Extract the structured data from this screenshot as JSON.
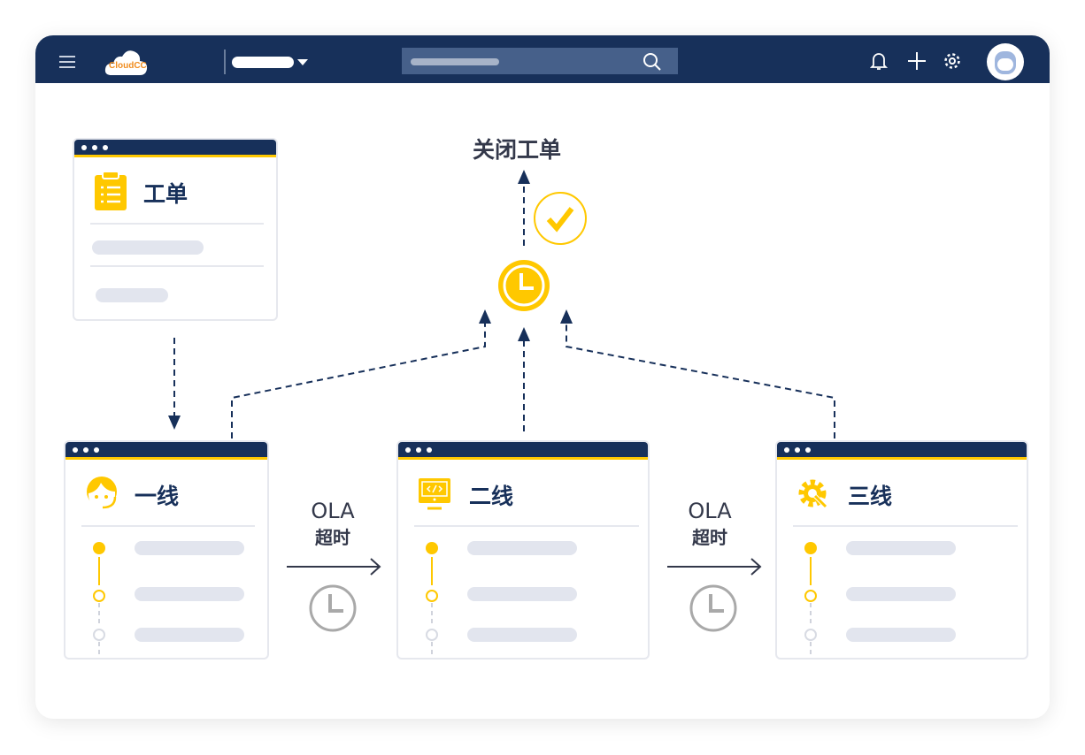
{
  "header": {
    "logo_text": "CloudCC",
    "icons": [
      "menu-icon",
      "search-icon",
      "bell-icon",
      "plus-icon",
      "gear-icon",
      "avatar"
    ]
  },
  "ticket_card": {
    "title": "工单",
    "icon": "clipboard-icon"
  },
  "close_label": "关闭工单",
  "tiers": [
    {
      "title": "一线",
      "icon": "support-agent-icon"
    },
    {
      "title": "二线",
      "icon": "monitor-code-icon"
    },
    {
      "title": "三线",
      "icon": "gear-wrench-icon"
    }
  ],
  "ola": [
    {
      "line1": "OLA",
      "line2": "超时"
    },
    {
      "line1": "OLA",
      "line2": "超时"
    }
  ],
  "colors": {
    "navy": "#17305a",
    "yellow": "#ffc800",
    "gray": "#a9a9a9"
  }
}
